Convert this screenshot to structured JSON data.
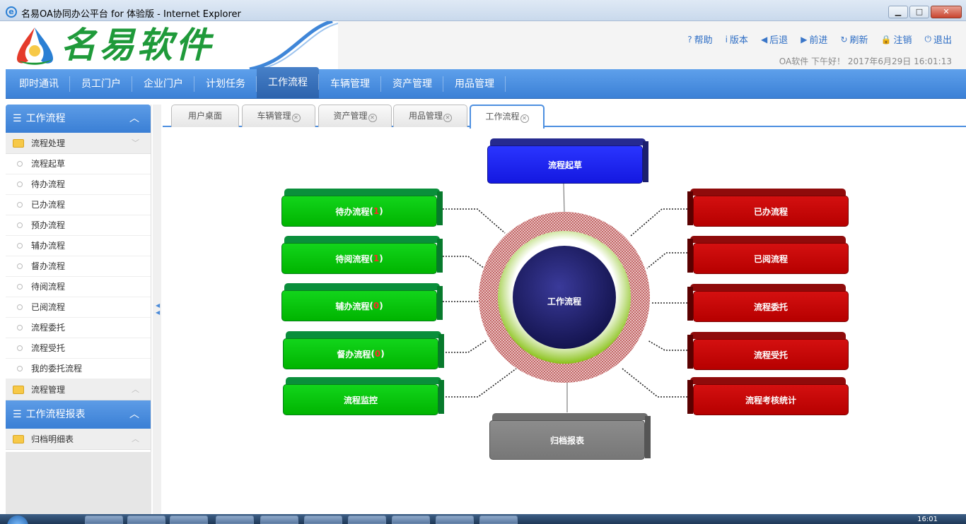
{
  "window": {
    "title": "名易OA协同办公平台 for 体验版 - Internet Explorer",
    "min_label": "▁",
    "max_label": "□",
    "close_label": "✕"
  },
  "header": {
    "logo_text": "名易软件",
    "links": [
      {
        "icon": "?",
        "label": "帮助"
      },
      {
        "icon": "i",
        "label": "版本"
      },
      {
        "icon": "◀",
        "label": "后退"
      },
      {
        "icon": "▶",
        "label": "前进"
      },
      {
        "icon": "↻",
        "label": "刷新"
      },
      {
        "icon": "🔒",
        "label": "注销"
      },
      {
        "icon": "⏻",
        "label": "退出"
      }
    ],
    "greeting": "OA软件 下午好！ 2017年6月29日 16:01:13"
  },
  "nav": {
    "items": [
      "即时通讯",
      "员工门户",
      "企业门户",
      "计划任务",
      "工作流程",
      "车辆管理",
      "资产管理",
      "用品管理"
    ],
    "active_index": 4
  },
  "sidebar": {
    "section1_title": "工作流程",
    "group1": "流程处理",
    "items": [
      "流程起草",
      "待办流程",
      "已办流程",
      "预办流程",
      "辅办流程",
      "督办流程",
      "待阅流程",
      "已阅流程",
      "流程委托",
      "流程受托",
      "我的委托流程"
    ],
    "group2": "流程管理",
    "section2_title": "工作流程报表",
    "group3": "归档明细表"
  },
  "tabs": [
    {
      "label": "用户桌面",
      "closable": false
    },
    {
      "label": "车辆管理",
      "closable": true
    },
    {
      "label": "资产管理",
      "closable": true
    },
    {
      "label": "用品管理",
      "closable": true
    },
    {
      "label": "工作流程",
      "closable": true,
      "active": true
    }
  ],
  "diagram": {
    "center": "工作流程",
    "top": "流程起草",
    "bottom": "归档报表",
    "left": [
      {
        "label": "待办流程",
        "count": "1"
      },
      {
        "label": "待阅流程",
        "count": "1"
      },
      {
        "label": "辅办流程",
        "count": "0"
      },
      {
        "label": "督办流程",
        "count": "0"
      },
      {
        "label": "流程监控",
        "count": ""
      }
    ],
    "right": [
      "已办流程",
      "已阅流程",
      "流程委托",
      "流程受托",
      "流程考核统计"
    ],
    "colors": {
      "green": "#00c400",
      "red": "#c00000",
      "blue": "#1a1ef0",
      "gray": "#808080",
      "center": "#1e1e6e"
    }
  },
  "taskbar": {
    "clock": "16:01"
  }
}
